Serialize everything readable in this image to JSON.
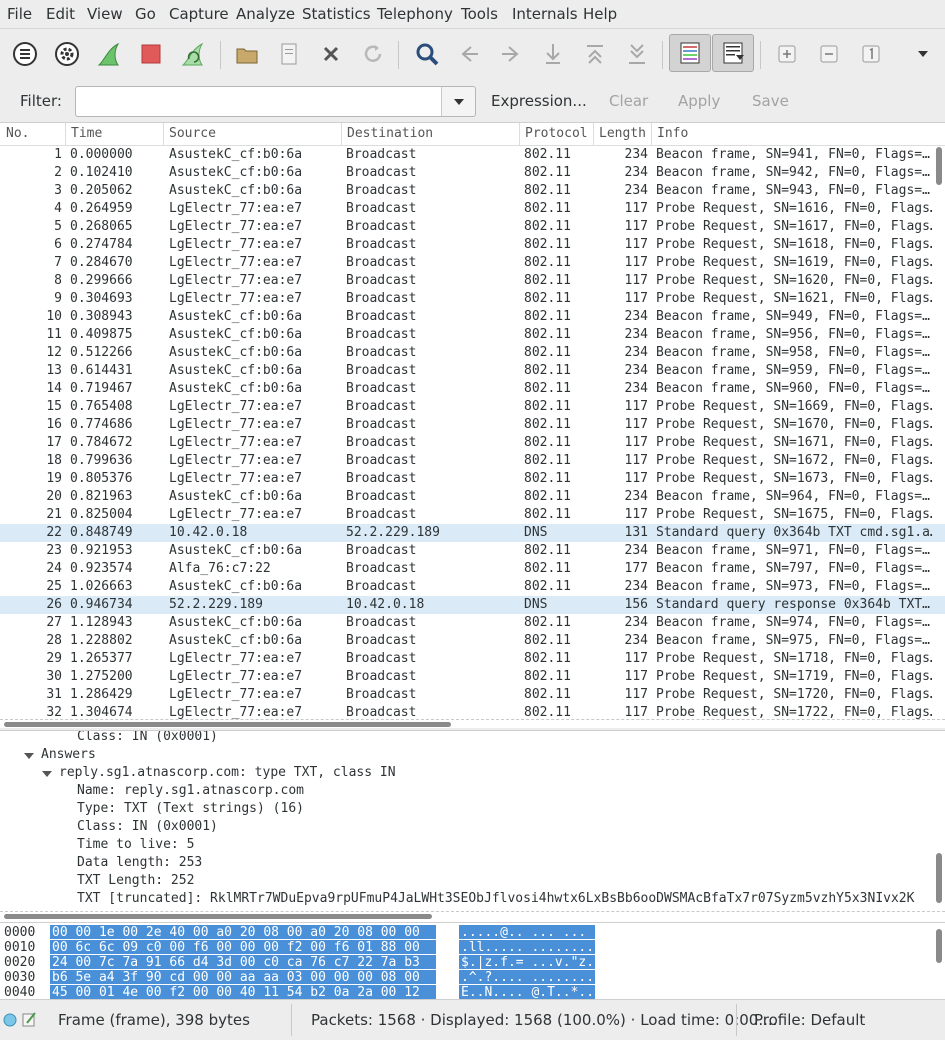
{
  "menu": [
    "File",
    "Edit",
    "View",
    "Go",
    "Capture",
    "Analyze",
    "Statistics",
    "Telephony",
    "Tools",
    "Internals",
    "Help"
  ],
  "filter": {
    "label": "Filter:",
    "value": "",
    "expression": "Expression...",
    "clear": "Clear",
    "apply": "Apply",
    "save": "Save"
  },
  "columns": [
    "No.",
    "Time",
    "Source",
    "Destination",
    "Protocol",
    "Length",
    "Info"
  ],
  "packets": [
    {
      "no": "1",
      "time": "0.000000",
      "src": "AsustekC_cf:b0:6a",
      "dst": "Broadcast",
      "proto": "802.11",
      "len": "234",
      "info": "Beacon frame, SN=941, FN=0, Flags=…"
    },
    {
      "no": "2",
      "time": "0.102410",
      "src": "AsustekC_cf:b0:6a",
      "dst": "Broadcast",
      "proto": "802.11",
      "len": "234",
      "info": "Beacon frame, SN=942, FN=0, Flags=…"
    },
    {
      "no": "3",
      "time": "0.205062",
      "src": "AsustekC_cf:b0:6a",
      "dst": "Broadcast",
      "proto": "802.11",
      "len": "234",
      "info": "Beacon frame, SN=943, FN=0, Flags=…"
    },
    {
      "no": "4",
      "time": "0.264959",
      "src": "LgElectr_77:ea:e7",
      "dst": "Broadcast",
      "proto": "802.11",
      "len": "117",
      "info": "Probe Request, SN=1616, FN=0, Flags…"
    },
    {
      "no": "5",
      "time": "0.268065",
      "src": "LgElectr_77:ea:e7",
      "dst": "Broadcast",
      "proto": "802.11",
      "len": "117",
      "info": "Probe Request, SN=1617, FN=0, Flags…"
    },
    {
      "no": "6",
      "time": "0.274784",
      "src": "LgElectr_77:ea:e7",
      "dst": "Broadcast",
      "proto": "802.11",
      "len": "117",
      "info": "Probe Request, SN=1618, FN=0, Flags…"
    },
    {
      "no": "7",
      "time": "0.284670",
      "src": "LgElectr_77:ea:e7",
      "dst": "Broadcast",
      "proto": "802.11",
      "len": "117",
      "info": "Probe Request, SN=1619, FN=0, Flags…"
    },
    {
      "no": "8",
      "time": "0.299666",
      "src": "LgElectr_77:ea:e7",
      "dst": "Broadcast",
      "proto": "802.11",
      "len": "117",
      "info": "Probe Request, SN=1620, FN=0, Flags…"
    },
    {
      "no": "9",
      "time": "0.304693",
      "src": "LgElectr_77:ea:e7",
      "dst": "Broadcast",
      "proto": "802.11",
      "len": "117",
      "info": "Probe Request, SN=1621, FN=0, Flags…"
    },
    {
      "no": "10",
      "time": "0.308943",
      "src": "AsustekC_cf:b0:6a",
      "dst": "Broadcast",
      "proto": "802.11",
      "len": "234",
      "info": "Beacon frame, SN=949, FN=0, Flags=…"
    },
    {
      "no": "11",
      "time": "0.409875",
      "src": "AsustekC_cf:b0:6a",
      "dst": "Broadcast",
      "proto": "802.11",
      "len": "234",
      "info": "Beacon frame, SN=956, FN=0, Flags=…"
    },
    {
      "no": "12",
      "time": "0.512266",
      "src": "AsustekC_cf:b0:6a",
      "dst": "Broadcast",
      "proto": "802.11",
      "len": "234",
      "info": "Beacon frame, SN=958, FN=0, Flags=…"
    },
    {
      "no": "13",
      "time": "0.614431",
      "src": "AsustekC_cf:b0:6a",
      "dst": "Broadcast",
      "proto": "802.11",
      "len": "234",
      "info": "Beacon frame, SN=959, FN=0, Flags=…"
    },
    {
      "no": "14",
      "time": "0.719467",
      "src": "AsustekC_cf:b0:6a",
      "dst": "Broadcast",
      "proto": "802.11",
      "len": "234",
      "info": "Beacon frame, SN=960, FN=0, Flags=…"
    },
    {
      "no": "15",
      "time": "0.765408",
      "src": "LgElectr_77:ea:e7",
      "dst": "Broadcast",
      "proto": "802.11",
      "len": "117",
      "info": "Probe Request, SN=1669, FN=0, Flags…"
    },
    {
      "no": "16",
      "time": "0.774686",
      "src": "LgElectr_77:ea:e7",
      "dst": "Broadcast",
      "proto": "802.11",
      "len": "117",
      "info": "Probe Request, SN=1670, FN=0, Flags…"
    },
    {
      "no": "17",
      "time": "0.784672",
      "src": "LgElectr_77:ea:e7",
      "dst": "Broadcast",
      "proto": "802.11",
      "len": "117",
      "info": "Probe Request, SN=1671, FN=0, Flags…"
    },
    {
      "no": "18",
      "time": "0.799636",
      "src": "LgElectr_77:ea:e7",
      "dst": "Broadcast",
      "proto": "802.11",
      "len": "117",
      "info": "Probe Request, SN=1672, FN=0, Flags…"
    },
    {
      "no": "19",
      "time": "0.805376",
      "src": "LgElectr_77:ea:e7",
      "dst": "Broadcast",
      "proto": "802.11",
      "len": "117",
      "info": "Probe Request, SN=1673, FN=0, Flags…"
    },
    {
      "no": "20",
      "time": "0.821963",
      "src": "AsustekC_cf:b0:6a",
      "dst": "Broadcast",
      "proto": "802.11",
      "len": "234",
      "info": "Beacon frame, SN=964, FN=0, Flags=…"
    },
    {
      "no": "21",
      "time": "0.825004",
      "src": "LgElectr_77:ea:e7",
      "dst": "Broadcast",
      "proto": "802.11",
      "len": "117",
      "info": "Probe Request, SN=1675, FN=0, Flags…"
    },
    {
      "no": "22",
      "time": "0.848749",
      "src": "10.42.0.18",
      "dst": "52.2.229.189",
      "proto": "DNS",
      "len": "131",
      "info": "Standard query 0x364b TXT cmd.sg1.a…"
    },
    {
      "no": "23",
      "time": "0.921953",
      "src": "AsustekC_cf:b0:6a",
      "dst": "Broadcast",
      "proto": "802.11",
      "len": "234",
      "info": "Beacon frame, SN=971, FN=0, Flags=…"
    },
    {
      "no": "24",
      "time": "0.923574",
      "src": "Alfa_76:c7:22",
      "dst": "Broadcast",
      "proto": "802.11",
      "len": "177",
      "info": "Beacon frame, SN=797, FN=0, Flags=…"
    },
    {
      "no": "25",
      "time": "1.026663",
      "src": "AsustekC_cf:b0:6a",
      "dst": "Broadcast",
      "proto": "802.11",
      "len": "234",
      "info": "Beacon frame, SN=973, FN=0, Flags=…"
    },
    {
      "no": "26",
      "time": "0.946734",
      "src": "52.2.229.189",
      "dst": "10.42.0.18",
      "proto": "DNS",
      "len": "156",
      "info": "Standard query response 0x364b TXT…"
    },
    {
      "no": "27",
      "time": "1.128943",
      "src": "AsustekC_cf:b0:6a",
      "dst": "Broadcast",
      "proto": "802.11",
      "len": "234",
      "info": "Beacon frame, SN=974, FN=0, Flags=…"
    },
    {
      "no": "28",
      "time": "1.228802",
      "src": "AsustekC_cf:b0:6a",
      "dst": "Broadcast",
      "proto": "802.11",
      "len": "234",
      "info": "Beacon frame, SN=975, FN=0, Flags=…"
    },
    {
      "no": "29",
      "time": "1.265377",
      "src": "LgElectr_77:ea:e7",
      "dst": "Broadcast",
      "proto": "802.11",
      "len": "117",
      "info": "Probe Request, SN=1718, FN=0, Flags…"
    },
    {
      "no": "30",
      "time": "1.275200",
      "src": "LgElectr_77:ea:e7",
      "dst": "Broadcast",
      "proto": "802.11",
      "len": "117",
      "info": "Probe Request, SN=1719, FN=0, Flags…"
    },
    {
      "no": "31",
      "time": "1.286429",
      "src": "LgElectr_77:ea:e7",
      "dst": "Broadcast",
      "proto": "802.11",
      "len": "117",
      "info": "Probe Request, SN=1720, FN=0, Flags…"
    },
    {
      "no": "32",
      "time": "1.304674",
      "src": "LgElectr_77:ea:e7",
      "dst": "Broadcast",
      "proto": "802.11",
      "len": "117",
      "info": "Probe Request, SN=1722, FN=0, Flags…"
    }
  ],
  "details": {
    "class_top": "Class: IN (0x0001)",
    "answers": "Answers",
    "answer_record": "reply.sg1.atnascorp.com: type TXT, class IN",
    "name": "Name: reply.sg1.atnascorp.com",
    "type": "Type: TXT (Text strings) (16)",
    "class": "Class: IN (0x0001)",
    "ttl": "Time to live: 5",
    "data_length": "Data length: 253",
    "txt_length": "TXT Length: 252",
    "txt": "TXT [truncated]: RklMRTr7WDuEpva9rpUFmuP4JaLWHt3SEObJflvosi4hwtx6LxBsBb6ooDWSMAcBfaTx7r07Syzm5vzhY5x3NIvx2K"
  },
  "hex": [
    {
      "offset": "0000",
      "bytes": "00 00 1e 00 2e 40 00 a0  20 08 00 a0 20 08 00 00",
      "ascii": ".....@..  ... ..."
    },
    {
      "offset": "0010",
      "bytes": "00 6c 6c 09 c0 00 f6 00  00 00 f2 00 f6 01 88 00",
      "ascii": ".ll..... ........"
    },
    {
      "offset": "0020",
      "bytes": "24 00 7c 7a 91 66 d4 3d  00 c0 ca 76 c7 22 7a b3",
      "ascii": "$.|z.f.= ...v.\"z."
    },
    {
      "offset": "0030",
      "bytes": "b6 5e a4 3f 90 cd 00 00  aa aa 03 00 00 00 08 00",
      "ascii": ".^.?.... ........"
    },
    {
      "offset": "0040",
      "bytes": "45 00 01 4e 00 f2 00 00  40 11 54 b2 0a 2a 00 12",
      "ascii": "E..N.... @.T..*.."
    }
  ],
  "status": {
    "frame": "Frame (frame), 398 bytes",
    "packets": "Packets: 1568 · Displayed: 1568 (100.0%)  · Load time: 0:00....",
    "profile": "Profile: Default"
  },
  "colors": {
    "dns_row": "#dbeaf7",
    "hex_selection": "#4a90d9",
    "background": "#ededed"
  }
}
